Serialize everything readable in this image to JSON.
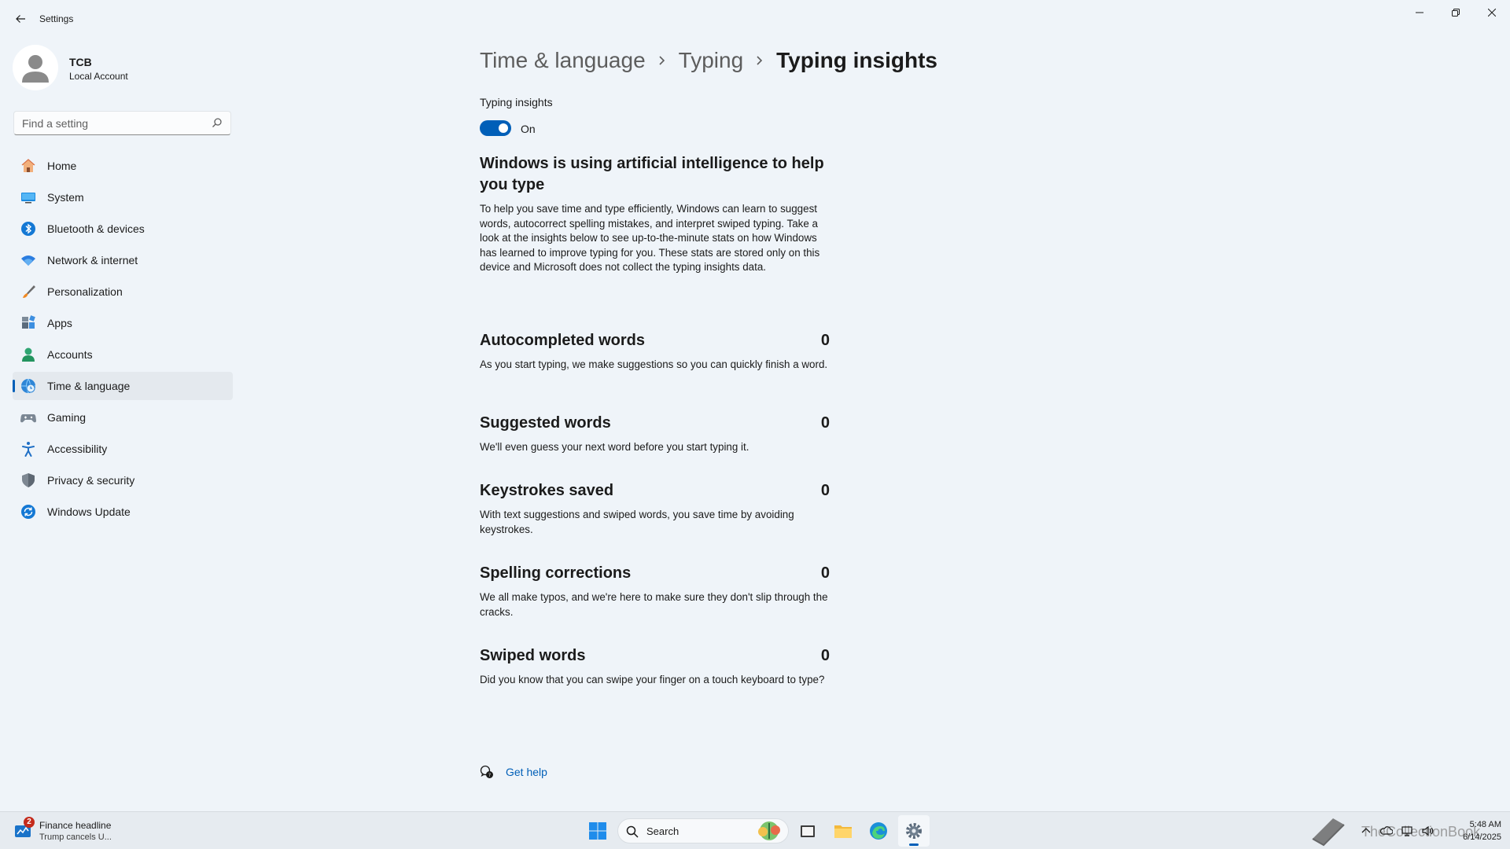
{
  "window": {
    "title": "Settings",
    "controls": {
      "minimize": "minimize-icon",
      "restore": "restore-icon",
      "close": "close-icon"
    }
  },
  "profile": {
    "name": "TCB",
    "account_type": "Local Account"
  },
  "search": {
    "placeholder": "Find a setting"
  },
  "sidebar": {
    "items": [
      {
        "label": "Home",
        "icon": "home-icon",
        "active": false
      },
      {
        "label": "System",
        "icon": "monitor-icon",
        "active": false
      },
      {
        "label": "Bluetooth & devices",
        "icon": "bluetooth-icon",
        "active": false
      },
      {
        "label": "Network & internet",
        "icon": "wifi-icon",
        "active": false
      },
      {
        "label": "Personalization",
        "icon": "brush-icon",
        "active": false
      },
      {
        "label": "Apps",
        "icon": "apps-icon",
        "active": false
      },
      {
        "label": "Accounts",
        "icon": "person-icon",
        "active": false
      },
      {
        "label": "Time & language",
        "icon": "globe-clock-icon",
        "active": true
      },
      {
        "label": "Gaming",
        "icon": "gamepad-icon",
        "active": false
      },
      {
        "label": "Accessibility",
        "icon": "accessibility-icon",
        "active": false
      },
      {
        "label": "Privacy & security",
        "icon": "shield-icon",
        "active": false
      },
      {
        "label": "Windows Update",
        "icon": "update-icon",
        "active": false
      }
    ]
  },
  "breadcrumb": {
    "items": [
      "Time & language",
      "Typing",
      "Typing insights"
    ]
  },
  "toggle": {
    "title": "Typing insights",
    "state": "On",
    "on": true
  },
  "intro": {
    "heading": "Windows is using artificial intelligence to help you type",
    "description": "To help you save time and type efficiently, Windows can learn to suggest words, autocorrect spelling mistakes, and interpret swiped typing. Take a look at the insights below to see up-to-the-minute stats on how Windows has learned to improve typing for you. These stats are stored only on this device and Microsoft does not collect the typing insights data."
  },
  "stats": [
    {
      "title": "Autocompleted words",
      "value": "0",
      "description": "As you start typing, we make suggestions so you can quickly finish a word."
    },
    {
      "title": "Suggested words",
      "value": "0",
      "description": "We'll even guess your next word before you start typing it."
    },
    {
      "title": "Keystrokes saved",
      "value": "0",
      "description": "With text suggestions and swiped words, you save time by avoiding keystrokes."
    },
    {
      "title": "Spelling corrections",
      "value": "0",
      "description": "We all make typos, and we're here to make sure they don't slip through the cracks."
    },
    {
      "title": "Swiped words",
      "value": "0",
      "description": "Did you know that you can swipe your finger on a touch keyboard to type?"
    }
  ],
  "help": {
    "label": "Get help"
  },
  "taskbar": {
    "widget": {
      "badge": "2",
      "title": "Finance headline",
      "subtitle": "Trump cancels U..."
    },
    "search_label": "Search",
    "apps": [
      "start-icon",
      "file-explorer-icon",
      "folder-icon",
      "edge-icon",
      "settings-icon"
    ],
    "watermark": "TheCollectionBook",
    "clock": {
      "time": "5:48 AM",
      "date": "6/14/2025"
    }
  },
  "colors": {
    "accent": "#005fb8",
    "background": "#eff4f9",
    "badge": "#c42b1c"
  }
}
